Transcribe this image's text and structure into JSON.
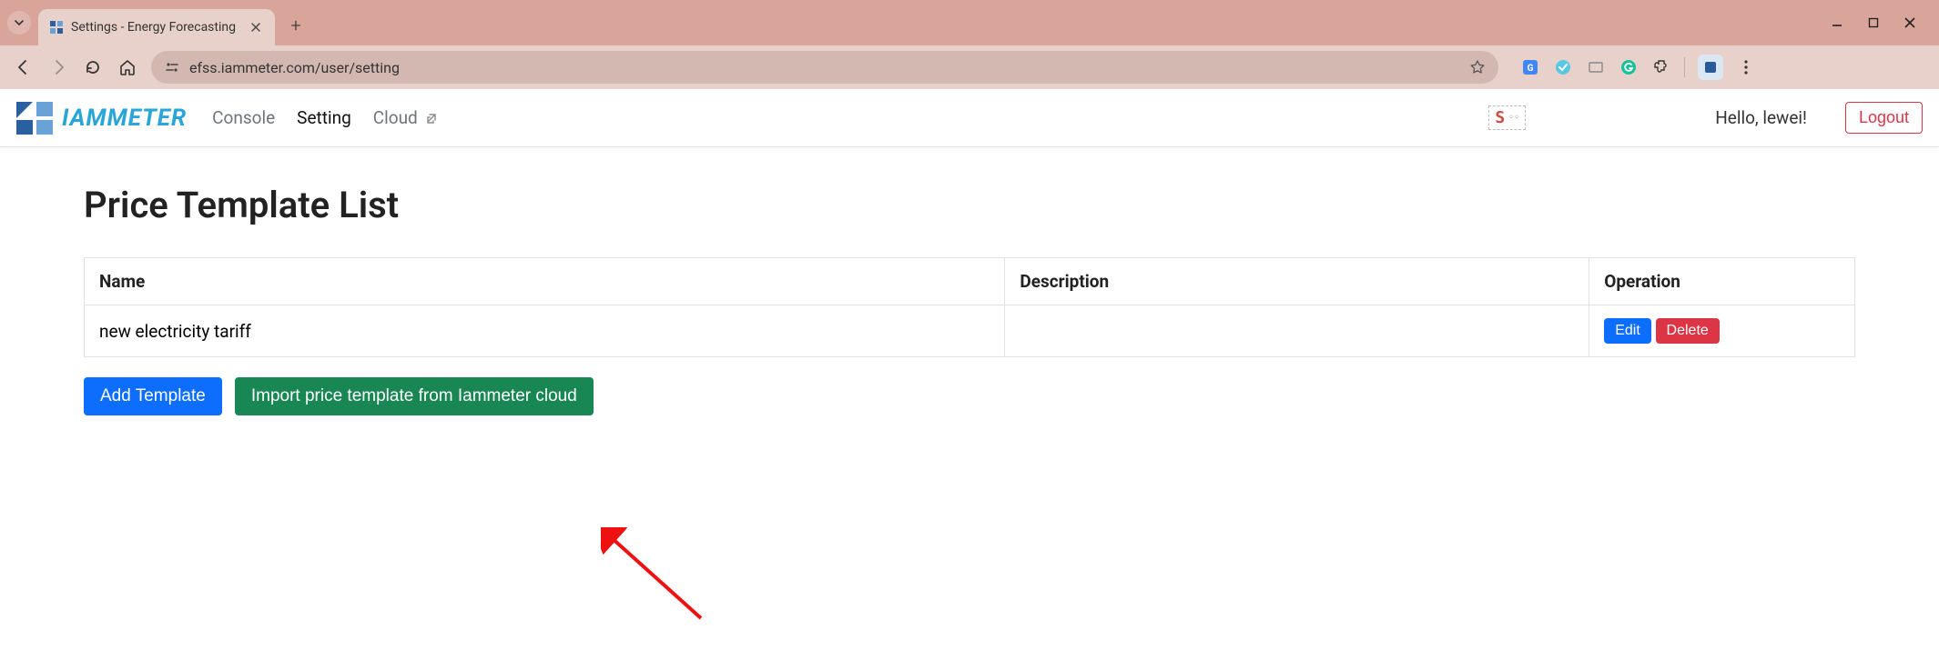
{
  "browser": {
    "tab_title": "Settings - Energy Forecasting",
    "url": "efss.iammeter.com/user/setting"
  },
  "header": {
    "brand": "IAMMETER",
    "nav": {
      "console": "Console",
      "setting": "Setting",
      "cloud": "Cloud"
    },
    "greeting": "Hello, lewei!",
    "logout": "Logout"
  },
  "page": {
    "title": "Price Template List",
    "columns": {
      "name": "Name",
      "description": "Description",
      "operation": "Operation"
    },
    "rows": [
      {
        "name": "new electricity tariff",
        "description": ""
      }
    ],
    "row_actions": {
      "edit": "Edit",
      "delete": "Delete"
    },
    "actions": {
      "add": "Add Template",
      "import": "Import price template from Iammeter cloud"
    }
  }
}
